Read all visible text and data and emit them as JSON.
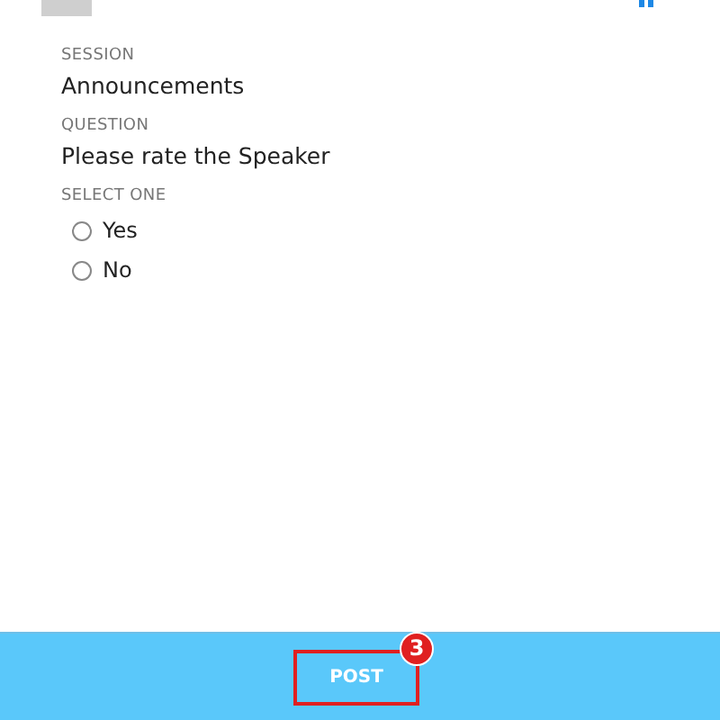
{
  "fields": [
    {
      "label": "SESSION",
      "value": "Announcements"
    },
    {
      "label": "QUESTION",
      "value": "Please rate the Speaker"
    }
  ],
  "choice": {
    "label": "SELECT ONE",
    "options": [
      {
        "label": "Yes",
        "selected": false
      },
      {
        "label": "No",
        "selected": false
      }
    ]
  },
  "footer": {
    "button": "POST",
    "highlighted": true,
    "step_badge": "3"
  }
}
